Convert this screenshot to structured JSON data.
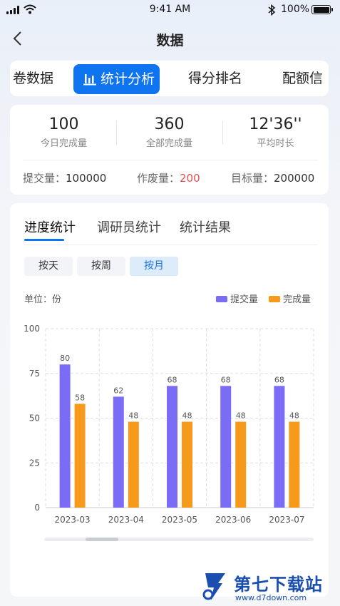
{
  "status_bar": {
    "time": "9:41 AM",
    "battery": "100%"
  },
  "nav": {
    "title": "数据"
  },
  "tabs": [
    {
      "label": "卷数据"
    },
    {
      "label": "统计分析",
      "active": true
    },
    {
      "label": "得分排名"
    },
    {
      "label": "配额信"
    }
  ],
  "summary": {
    "stats": [
      {
        "value": "100",
        "label": "今日完成量"
      },
      {
        "value": "360",
        "label": "全部完成量"
      },
      {
        "value": "12'36''",
        "label": "平均时长"
      }
    ],
    "submitted": {
      "label": "提交量：",
      "value": "100000"
    },
    "voided": {
      "label": "作废量：",
      "value": "200"
    },
    "target": {
      "label": "目标量：",
      "value": "200000"
    }
  },
  "subtabs": [
    {
      "label": "进度统计",
      "active": true
    },
    {
      "label": "调研员统计"
    },
    {
      "label": "统计结果"
    }
  ],
  "segments": [
    {
      "label": "按天"
    },
    {
      "label": "按周"
    },
    {
      "label": "按月",
      "active": true
    }
  ],
  "unit_label": "单位：份",
  "colors": {
    "accent": "#0e74f0",
    "series_submitted": "#7b6cf6",
    "series_completed": "#f59a1b",
    "danger": "#e55050"
  },
  "chart_data": {
    "type": "bar",
    "categories": [
      "2023-03",
      "2023-04",
      "2023-05",
      "2023-06",
      "2023-07"
    ],
    "series": [
      {
        "name": "提交量",
        "values": [
          80,
          62,
          68,
          68,
          68
        ],
        "color": "#7b6cf6"
      },
      {
        "name": "完成量",
        "values": [
          58,
          48,
          48,
          48,
          48
        ],
        "color": "#f59a1b"
      }
    ],
    "ylim": [
      0,
      100
    ],
    "yticks": [
      0,
      25,
      50,
      75,
      100
    ],
    "grid": true,
    "legend": "top-right",
    "data_labels": true
  },
  "watermark": {
    "text": "第七下载站",
    "url": "www.d7down.com"
  }
}
